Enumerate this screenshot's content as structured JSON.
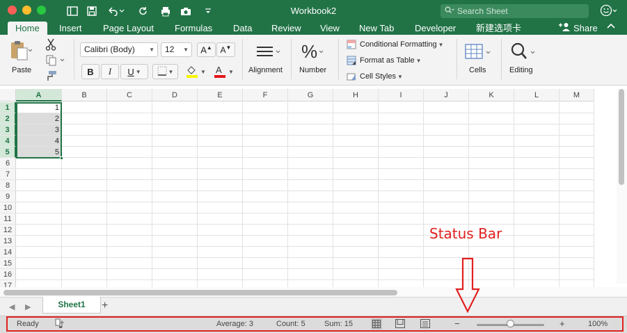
{
  "window": {
    "title": "Workbook2",
    "search_placeholder": "Search Sheet"
  },
  "tabs": [
    "Home",
    "Insert",
    "Page Layout",
    "Formulas",
    "Data",
    "Review",
    "View",
    "New Tab",
    "Developer",
    "新建选项卡"
  ],
  "share_label": "Share",
  "ribbon": {
    "paste_label": "Paste",
    "font_name": "Calibri (Body)",
    "font_size": "12",
    "bold": "B",
    "italic": "I",
    "underline": "U",
    "alignment_label": "Alignment",
    "number_label": "Number",
    "conditional_formatting": "Conditional Formatting",
    "format_as_table": "Format as Table",
    "cell_styles": "Cell Styles",
    "cells_label": "Cells",
    "editing_label": "Editing"
  },
  "grid": {
    "columns": [
      "A",
      "B",
      "C",
      "D",
      "E",
      "F",
      "G",
      "H",
      "I",
      "J",
      "K",
      "L",
      "M"
    ],
    "rows": [
      "1",
      "2",
      "3",
      "4",
      "5",
      "6",
      "7",
      "8",
      "9",
      "10",
      "11",
      "12",
      "13",
      "14",
      "15",
      "16",
      "17"
    ],
    "values_col_a": [
      "1",
      "2",
      "3",
      "4",
      "5"
    ]
  },
  "sheet_tab": "Sheet1",
  "status": {
    "ready": "Ready",
    "average": "Average: 3",
    "count": "Count: 5",
    "sum": "Sum: 15",
    "zoom": "100%",
    "zoom_fraction": 0.5
  },
  "annotation": {
    "text": "Status Bar"
  },
  "colors": {
    "accent": "#217346",
    "annotation": "#e0201f"
  }
}
